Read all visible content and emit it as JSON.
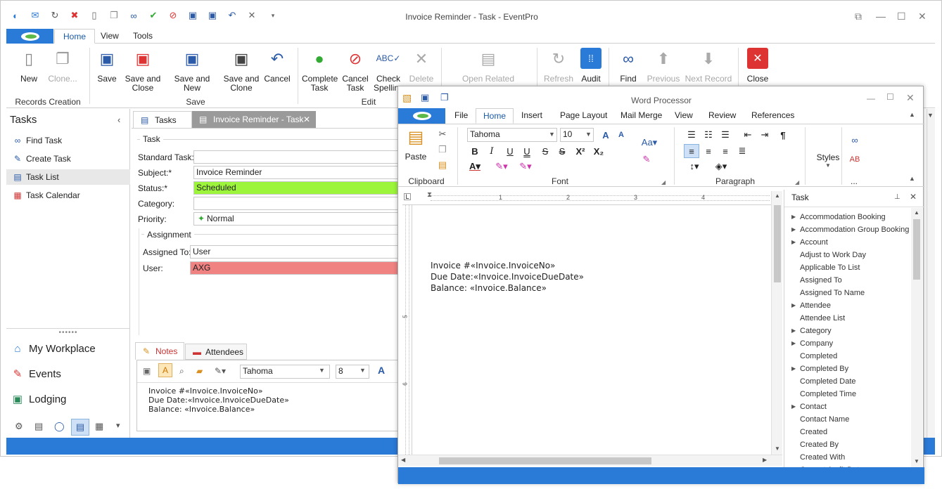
{
  "window": {
    "title": "Invoice Reminder - Task - EventPro"
  },
  "ribbon_tabs": [
    "Home",
    "View",
    "Tools"
  ],
  "ribbon": {
    "records": {
      "new": "New",
      "clone": "Clone...",
      "group": "Records Creation"
    },
    "save": {
      "save": "Save",
      "save_close": "Save and\nClose",
      "save_new": "Save and New",
      "save_clone": "Save and\nClone",
      "cancel": "Cancel",
      "group": "Save"
    },
    "edit": {
      "complete": "Complete\nTask",
      "cancel_task": "Cancel\nTask",
      "spelling": "Check\nSpelling",
      "delete": "Delete",
      "group": "Edit"
    },
    "open_related": "Open Related",
    "refresh": "Refresh",
    "audit": "Audit",
    "find": "Find",
    "previous": "Previous",
    "next": "Next Record",
    "close": "Close"
  },
  "leftnav": {
    "title": "Tasks",
    "items": [
      "Find Task",
      "Create Task",
      "Task List",
      "Task Calendar"
    ],
    "selected": "Task List",
    "bottom": [
      "My Workplace",
      "Events",
      "Lodging"
    ]
  },
  "doc_tabs": [
    "Tasks",
    "Invoice Reminder - Task"
  ],
  "form": {
    "group_task": "Task",
    "standard_task_label": "Standard Task:",
    "standard_task": "",
    "subject_label": "Subject:*",
    "subject": "Invoice Reminder",
    "status_label": "Status:*",
    "status": "Scheduled",
    "category_label": "Category:",
    "category": "",
    "priority_label": "Priority:",
    "priority": "Normal",
    "group_assignment": "Assignment",
    "assigned_to_label": "Assigned To:",
    "assigned_to": "User",
    "user_label": "User:",
    "user": "AXG",
    "status_color": "#9cf53a",
    "user_color": "#f08282"
  },
  "notes": {
    "tabs": [
      "Notes",
      "Attendees"
    ],
    "font": "Tahoma",
    "size": "8",
    "lines": [
      "Invoice #«Invoice.InvoiceNo»",
      "Due Date:«Invoice.InvoiceDueDate»",
      "Balance: «Invoice.Balance»"
    ]
  },
  "wp": {
    "title": "Word Processor",
    "tabs": [
      "File",
      "Home",
      "Insert",
      "Page Layout",
      "Mail Merge",
      "View",
      "Review",
      "References"
    ],
    "paste": "Paste",
    "font": "Tahoma",
    "size": "10",
    "groups": {
      "clipboard": "Clipboard",
      "font": "Font",
      "paragraph": "Paragraph",
      "styles": "Styles",
      "more": "..."
    },
    "ruler": [
      "1",
      "2",
      "3",
      "4",
      "5",
      "6"
    ],
    "doc_lines": [
      "Invoice #«Invoice.InvoiceNo»",
      "Due Date:«Invoice.InvoiceDueDate»",
      "Balance: «Invoice.Balance»"
    ],
    "panel_title": "Task",
    "fields": [
      {
        "name": "Accommodation Booking",
        "expand": true
      },
      {
        "name": "Accommodation Group Booking",
        "expand": true
      },
      {
        "name": "Account",
        "expand": true
      },
      {
        "name": "Adjust to Work Day",
        "expand": false
      },
      {
        "name": "Applicable To List",
        "expand": false
      },
      {
        "name": "Assigned To",
        "expand": false
      },
      {
        "name": "Assigned To Name",
        "expand": false
      },
      {
        "name": "Attendee",
        "expand": true
      },
      {
        "name": "Attendee List",
        "expand": false
      },
      {
        "name": "Category",
        "expand": true
      },
      {
        "name": "Company",
        "expand": true
      },
      {
        "name": "Completed",
        "expand": false
      },
      {
        "name": "Completed By",
        "expand": true
      },
      {
        "name": "Completed Date",
        "expand": false
      },
      {
        "name": "Completed Time",
        "expand": false
      },
      {
        "name": "Contact",
        "expand": true
      },
      {
        "name": "Contact Name",
        "expand": false
      },
      {
        "name": "Created",
        "expand": false
      },
      {
        "name": "Created By",
        "expand": false
      },
      {
        "name": "Created With",
        "expand": false
      },
      {
        "name": "Current Audit Data",
        "expand": true
      }
    ]
  }
}
